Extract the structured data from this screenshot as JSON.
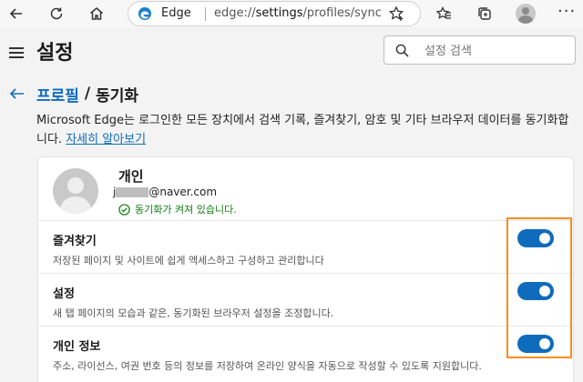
{
  "browser": {
    "brand": "Edge",
    "url_prefix": "edge://",
    "url_main": "settings",
    "url_rest": "/profiles/sync",
    "icons": [
      "back-icon",
      "refresh-icon",
      "home-icon",
      "edge-logo-icon",
      "add-favorite-icon",
      "favorites-icon",
      "collections-icon",
      "profile-avatar",
      "more-icon"
    ],
    "more_label": "···"
  },
  "header": {
    "title": "설정",
    "search_placeholder": "설정 검색"
  },
  "breadcrumb": {
    "parent": "프로필",
    "separator": "/",
    "current": "동기화"
  },
  "description": {
    "text": "Microsoft Edge는 로그인한 모든 장치에서 검색 기록, 즐겨찾기, 암호 및 기타 브라우저 데이터를 동기화합니다.",
    "link": "자세히 알아보기"
  },
  "profile": {
    "name": "개인",
    "email_prefix": "j",
    "email_domain": "@naver.com",
    "status": "동기화가 켜져 있습니다."
  },
  "sync_items": [
    {
      "title": "즐겨찾기",
      "description": "저장된 페이지 및 사이트에 쉽게 액세스하고 구성하고 관리합니다",
      "enabled": true
    },
    {
      "title": "설정",
      "description": "새 탭 페이지의 모습과 같은, 동기화된 브라우저 설정을 조정합니다.",
      "enabled": true
    },
    {
      "title": "개인 정보",
      "description": "주소, 라이선스, 여권 번호 등의 정보를 저장하여 온라인 양식을 자동으로 작성할 수 있도록 지원합니다.",
      "enabled": true
    }
  ],
  "colors": {
    "accent": "#0f6cbd",
    "success": "#107c10",
    "highlight": "#ff8c1a"
  }
}
